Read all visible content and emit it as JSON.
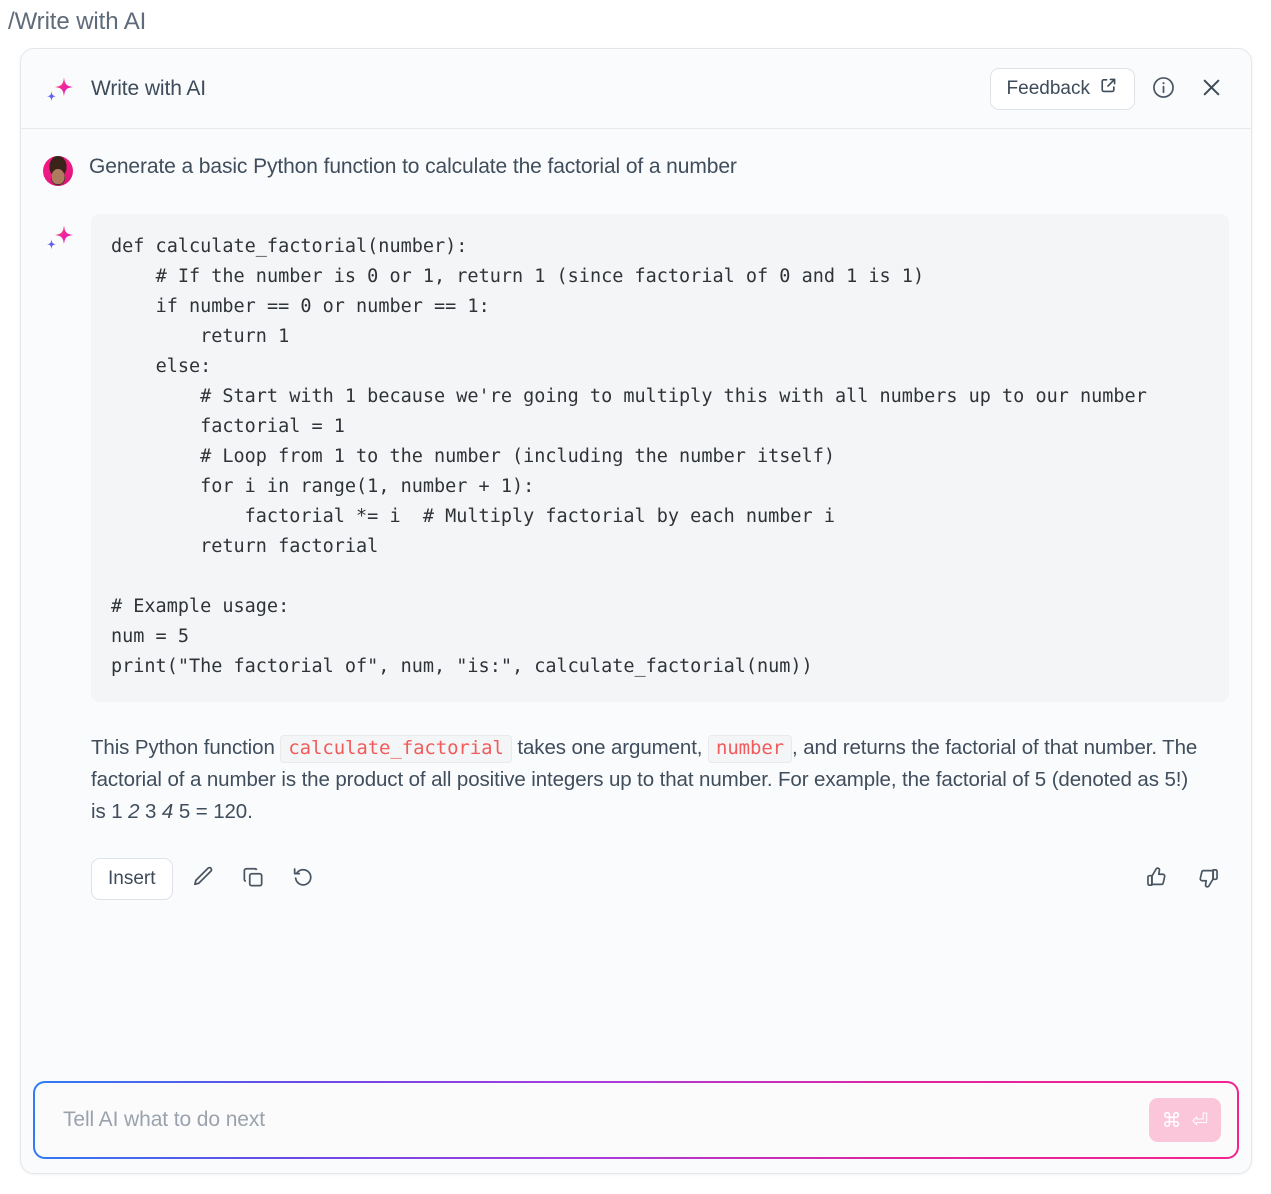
{
  "slash_command": "/Write with AI",
  "header": {
    "title": "Write with AI",
    "spark_icon": "ai-sparkle-icon",
    "feedback_label": "Feedback",
    "feedback_icon": "external-link-icon",
    "info_icon": "info-circle-icon",
    "close_icon": "close-x-icon"
  },
  "conversation": {
    "user": {
      "avatar": "user-avatar",
      "prompt": "Generate a basic Python function to calculate the factorial of a number"
    },
    "assistant": {
      "spark_icon": "ai-sparkle-icon",
      "code_language": "python",
      "code": "def calculate_factorial(number):\n    # If the number is 0 or 1, return 1 (since factorial of 0 and 1 is 1)\n    if number == 0 or number == 1:\n        return 1\n    else:\n        # Start with 1 because we're going to multiply this with all numbers up to our number\n        factorial = 1\n        # Loop from 1 to the number (including the number itself)\n        for i in range(1, number + 1):\n            factorial *= i  # Multiply factorial by each number i\n        return factorial\n\n# Example usage:\nnum = 5\nprint(\"The factorial of\", num, \"is:\", calculate_factorial(num))",
      "explanation": {
        "part1": "This Python function ",
        "code1": "calculate_factorial",
        "part2": " takes one argument, ",
        "code2": "number",
        "part3": ", and returns the factorial of that number. The factorial of a number is the product of all positive integers up to that number. For example, the factorial of 5 (denoted as 5!) is 1 ",
        "italic1": "2",
        "part4": " 3 ",
        "italic2": "4",
        "part5": " 5 = 120."
      }
    }
  },
  "actions": {
    "insert_label": "Insert",
    "edit_icon": "pencil-edit-icon",
    "copy_icon": "copy-icon",
    "retry_icon": "retry-refresh-icon",
    "thumbs_up_icon": "thumbs-up-icon",
    "thumbs_down_icon": "thumbs-down-icon"
  },
  "input": {
    "placeholder": "Tell AI what to do next",
    "value": "",
    "send_shortcut": "⌘",
    "send_enter": "⏎",
    "send_icon": "command-enter-send-icon"
  },
  "colors": {
    "accent_pink": "#f6238e",
    "accent_blue": "#2f7cf6",
    "accent_purple": "#a63ce0",
    "inline_code_text": "#f15b5b",
    "card_bg": "#fafbfc",
    "code_bg": "#f4f5f6",
    "text": "#3f4d5c",
    "send_btn_bg": "#fbc5da"
  }
}
